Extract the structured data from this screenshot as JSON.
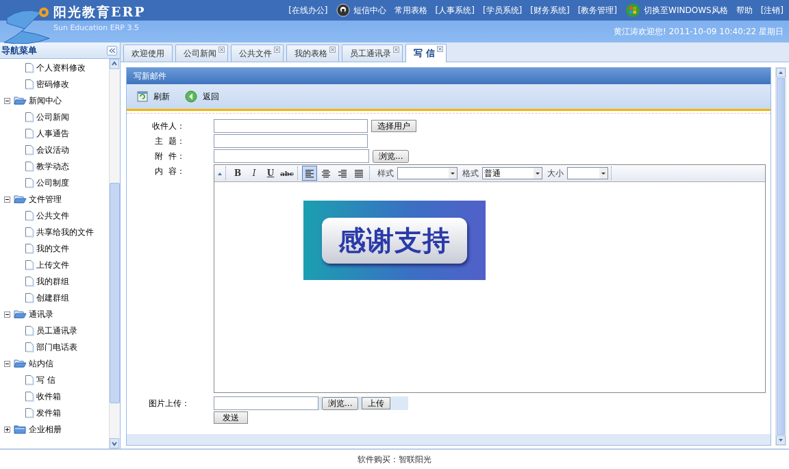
{
  "header": {
    "title": "阳光教育ERP",
    "subtitle": "Sun Education ERP 3.5",
    "nav": [
      {
        "label": "[在线办公]",
        "kind": "link"
      },
      {
        "label": "短信中心",
        "kind": "sms"
      },
      {
        "label": "常用表格",
        "kind": "link"
      },
      {
        "label": "[人事系统]",
        "kind": "link"
      },
      {
        "label": "[学员系统]",
        "kind": "link"
      },
      {
        "label": "[财务系统]",
        "kind": "link"
      },
      {
        "label": "[教务管理]",
        "kind": "link"
      },
      {
        "label": "切换至WINDOWS风格",
        "kind": "windows"
      },
      {
        "label": "帮助",
        "kind": "link"
      },
      {
        "label": "[注销]",
        "kind": "link"
      }
    ],
    "welcome": "黄江涛欢迎您! 2011-10-09 10:40:22 星期日"
  },
  "sidebar": {
    "title": "导航菜单",
    "tree": [
      {
        "label": "个人资料修改",
        "kind": "page"
      },
      {
        "label": "密码修改",
        "kind": "page"
      },
      {
        "label": "新闻中心",
        "kind": "folder",
        "expanded": true,
        "children": [
          {
            "label": "公司新闻",
            "kind": "page"
          },
          {
            "label": "人事通告",
            "kind": "page"
          },
          {
            "label": "会议活动",
            "kind": "page"
          },
          {
            "label": "教学动态",
            "kind": "page"
          },
          {
            "label": "公司制度",
            "kind": "page"
          }
        ]
      },
      {
        "label": "文件管理",
        "kind": "folder",
        "expanded": true,
        "children": [
          {
            "label": "公共文件",
            "kind": "page"
          },
          {
            "label": "共享给我的文件",
            "kind": "page"
          },
          {
            "label": "我的文件",
            "kind": "page"
          },
          {
            "label": "上传文件",
            "kind": "page"
          },
          {
            "label": "我的群组",
            "kind": "page"
          },
          {
            "label": "创建群组",
            "kind": "page"
          }
        ]
      },
      {
        "label": "通讯录",
        "kind": "folder",
        "expanded": true,
        "children": [
          {
            "label": "员工通讯录",
            "kind": "page"
          },
          {
            "label": "部门电话表",
            "kind": "page"
          }
        ]
      },
      {
        "label": "站内信",
        "kind": "folder",
        "expanded": true,
        "children": [
          {
            "label": "写 信",
            "kind": "page"
          },
          {
            "label": "收件箱",
            "kind": "page"
          },
          {
            "label": "发件箱",
            "kind": "page"
          }
        ]
      },
      {
        "label": "企业相册",
        "kind": "folder",
        "expanded": false
      }
    ]
  },
  "tabs": [
    {
      "label": "欢迎使用",
      "selected": false,
      "closable": false
    },
    {
      "label": "公司新闻",
      "selected": false,
      "closable": true
    },
    {
      "label": "公共文件",
      "selected": false,
      "closable": true
    },
    {
      "label": "我的表格",
      "selected": false,
      "closable": true
    },
    {
      "label": "员工通讯录",
      "selected": false,
      "closable": true
    },
    {
      "label": "写 信",
      "selected": true,
      "closable": true
    }
  ],
  "panel": {
    "title": "写新邮件",
    "toolbar": [
      {
        "label": "刷新",
        "kind": "refresh"
      },
      {
        "label": "返回",
        "kind": "back"
      }
    ],
    "form": {
      "recipient_label": "收件人：",
      "choose_user": "选择用户",
      "subject_label": "主  题：",
      "attachment_label": "附  件：",
      "browse": "浏览...",
      "content_label": "内  容：",
      "editor": {
        "format_buttons": [
          {
            "label": "B",
            "kind": "bold"
          },
          {
            "label": "I",
            "kind": "italic"
          },
          {
            "label": "U",
            "kind": "underline"
          },
          {
            "label": "abc",
            "kind": "strike"
          }
        ],
        "align_buttons": [
          {
            "kind": "left",
            "selected": true
          },
          {
            "kind": "center",
            "selected": false
          },
          {
            "kind": "right",
            "selected": false
          },
          {
            "kind": "justify",
            "selected": false
          }
        ],
        "selects": [
          {
            "label": "样式"
          },
          {
            "label": "格式",
            "value": "普通"
          },
          {
            "label": "大小"
          }
        ],
        "banner_text": "感谢支持"
      },
      "image_label": "图片上传：",
      "image_browse": "浏览...",
      "upload": "上传",
      "send": "发送"
    }
  },
  "footer": "软件购买：智联阳光"
}
